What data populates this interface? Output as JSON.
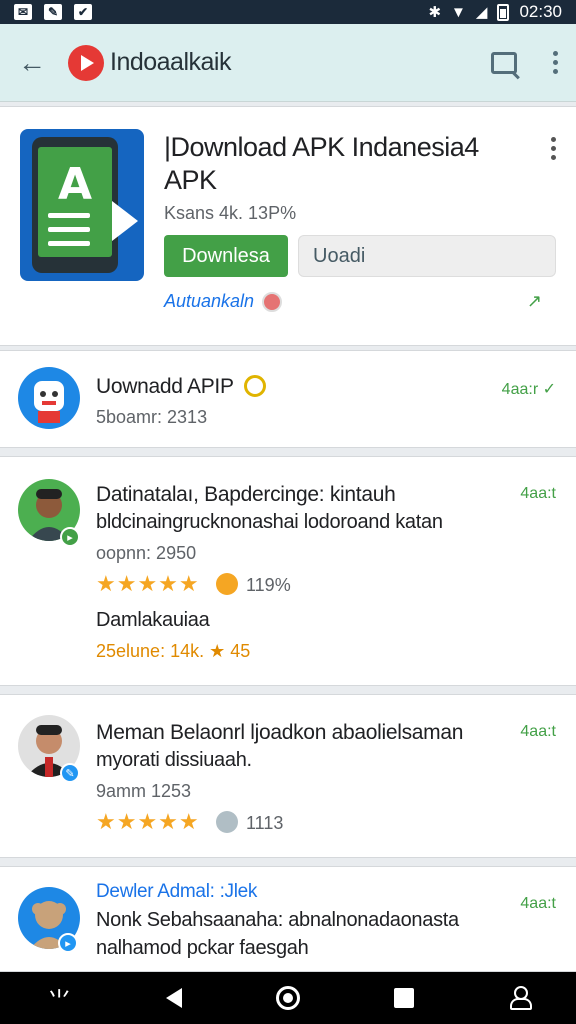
{
  "status_bar": {
    "time": "02:30"
  },
  "app_bar": {
    "title": "Indoaalkaik"
  },
  "hero": {
    "title": "|Download APK Indanesia4 APK",
    "meta": "Ksans 4k. 13P%",
    "download_label": "Downlesa",
    "secondary_label": "Uoadi",
    "link_text": "Autuankaln"
  },
  "items": [
    {
      "title": "Uownadd APIP",
      "sub": "5boamr: 2313",
      "time": "4aa:r ✓"
    },
    {
      "title": "Datinatalaı, Bapdercinge: kintauh",
      "line": "bldcinaingrucknonashai lodoroand katan",
      "sub": "oopnn: 2950",
      "stars": "★★★★★",
      "rating": "119%",
      "extra_title": "Damlakauiaa",
      "extra_line": "25elune: 14k. ★ 45",
      "time": "4aa:t"
    },
    {
      "title": "Meman Belaonrl ljoadkon abaolielsaman",
      "line": "myorati dissiuaah.",
      "sub": "9amm 1253",
      "stars": "★★★★★",
      "rating": "1113",
      "time": "4aa:t"
    },
    {
      "title": "Dewler Admal: :Jlek",
      "line": "Nonk Sebahsaanaha: abnalnonadaonasta",
      "line2": "nalhamod pckar faesgah",
      "time": "4aa:t"
    }
  ]
}
